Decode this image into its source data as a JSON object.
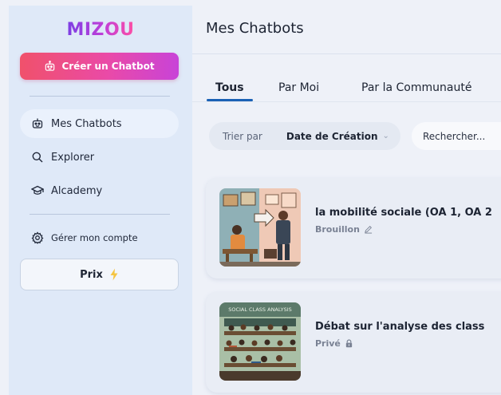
{
  "sidebar": {
    "logo": "MIZOU",
    "create_button": "Créer un Chatbot",
    "items": [
      {
        "label": "Mes Chatbots"
      },
      {
        "label": "Explorer"
      },
      {
        "label": "Alcademy"
      }
    ],
    "account": "Gérer mon compte",
    "prix": "Prix"
  },
  "main": {
    "title": "Mes Chatbots",
    "tabs": [
      {
        "label": "Tous"
      },
      {
        "label": "Par Moi"
      },
      {
        "label": "Par la Communauté"
      }
    ],
    "sort": {
      "label": "Trier par",
      "value": "Date de Création"
    },
    "search": {
      "placeholder": "Rechercher..."
    },
    "cards": [
      {
        "title": "la mobilité sociale (OA 1, OA 2",
        "status": "Brouillon"
      },
      {
        "title": "Débat sur l'analyse des class",
        "status": "Privé",
        "image_caption": "SOCIAL CLASS ANALYSIS"
      }
    ]
  },
  "colors": {
    "accent": "#1a61b5",
    "sidebar_bg": "#dfe9f8",
    "create_start": "#f0516b",
    "create_end": "#c843d8"
  }
}
